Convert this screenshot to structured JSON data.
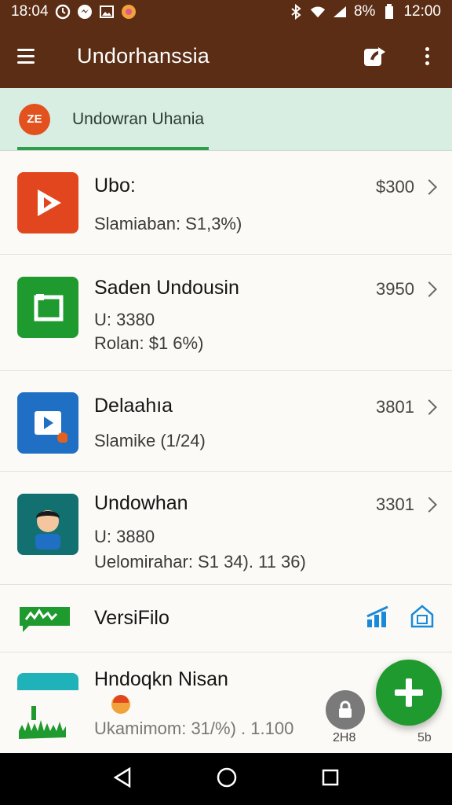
{
  "status_bar": {
    "time_left": "18:04",
    "battery_text": "8%",
    "time_right": "12:00"
  },
  "app_bar": {
    "title": "Undorhanssia"
  },
  "tab": {
    "badge": "ZE",
    "label": "Undowran Uhania"
  },
  "list": [
    {
      "name": "Ubo:",
      "line1": "Slamiaban: S1,3%)",
      "line2": "",
      "value": "$300",
      "color": "#e2461e"
    },
    {
      "name": "Saden Undousin",
      "line1": "U: 3380",
      "line2": "Rolan: $1 6%)",
      "value": "3950",
      "color": "#1f9a2e"
    },
    {
      "name": "Delaahıa",
      "line1": "Slamike (1/24)",
      "line2": "",
      "value": "3801",
      "color": "#1f6fc4"
    },
    {
      "name": "Undowhan",
      "line1": "U: 3880",
      "line2": "Uelomirahar: S1 34). 11 36)",
      "value": "3301",
      "color": "#137070"
    },
    {
      "name": "VersiFilo",
      "line1": "",
      "line2": "",
      "value": "",
      "color": "#1f9a2e"
    }
  ],
  "partial_row": {
    "name": "Hndoqkn Nisan",
    "line1": "Ukamimom: 31/%) . 1.100",
    "mid_label": "2H8",
    "right_label": "5b"
  },
  "colors": {
    "brand": "#5b2d14",
    "tab_bg": "#d8eee2",
    "accent_green": "#1f9a2e",
    "chart_blue": "#1a8ad8"
  }
}
